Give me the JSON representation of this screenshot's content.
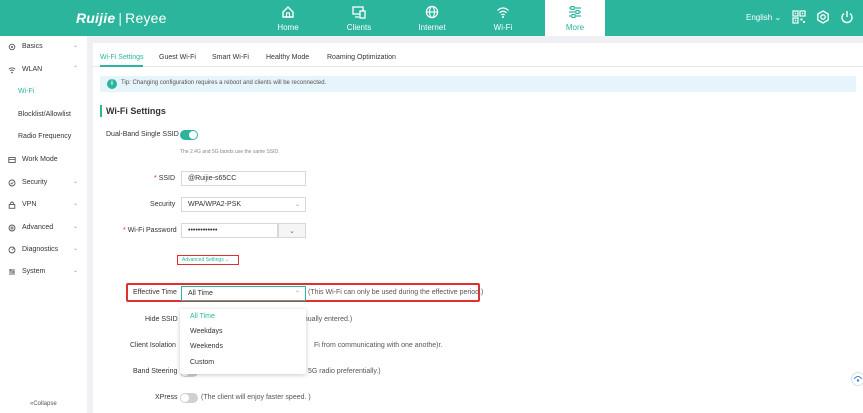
{
  "header": {
    "logo_brand": "Ruijie",
    "logo_sep": "|",
    "logo_sub": "Reyee",
    "nav": [
      {
        "label": "Home",
        "icon": "home-icon"
      },
      {
        "label": "Clients",
        "icon": "clients-icon"
      },
      {
        "label": "Internet",
        "icon": "globe-icon"
      },
      {
        "label": "Wi-Fi",
        "icon": "wifi-icon"
      },
      {
        "label": "More",
        "icon": "more-icon",
        "active": true
      }
    ],
    "language": "English",
    "language_caret": "⌄",
    "icons": [
      "qr-code-icon",
      "network-icon",
      "logout-icon"
    ]
  },
  "sidebar": {
    "items": [
      {
        "label": "Basics",
        "icon": "gear-icon",
        "chevron": "⌄"
      },
      {
        "label": "WLAN",
        "icon": "wifi-icon",
        "chevron": "⌃"
      },
      {
        "label": "Work Mode",
        "icon": "work-mode-icon",
        "chevron": ""
      },
      {
        "label": "Security",
        "icon": "security-icon",
        "chevron": "⌄"
      },
      {
        "label": "VPN",
        "icon": "vpn-icon",
        "chevron": "⌄"
      },
      {
        "label": "Advanced",
        "icon": "advanced-icon",
        "chevron": "⌄"
      },
      {
        "label": "Diagnostics",
        "icon": "diagnostics-icon",
        "chevron": "⌄"
      },
      {
        "label": "System",
        "icon": "system-icon",
        "chevron": "⌄"
      }
    ],
    "sub_items": [
      {
        "label": "Wi-Fi",
        "active": true
      },
      {
        "label": "Blocklist/Allowlist"
      },
      {
        "label": "Radio Frequency"
      }
    ],
    "collapse": "«Collapse"
  },
  "tabs": [
    "Wi-Fi Settings",
    "Guest Wi-Fi",
    "Smart Wi-Fi",
    "Healthy Mode",
    "Roaming Optimization"
  ],
  "tip": {
    "icon": "i",
    "text": "Tip: Changing configuration requires a reboot and clients will be reconnected."
  },
  "section_title": "Wi-Fi Settings",
  "form": {
    "dual_band_label": "Dual-Band Single SSID",
    "dual_band_on": true,
    "dual_band_hint": "The 2.4G and 5G bands use the same SSID.",
    "required_mark": "*",
    "ssid_label": "SSID",
    "ssid_value": "@Ruijie-s65CC",
    "security_label": "Security",
    "security_value": "WPA/WPA2-PSK",
    "select_arrow": "⌄",
    "password_label": "Wi-Fi Password",
    "password_value": "••••••••••••",
    "password_toggle": "⌄",
    "advanced_link": "Advanced Settings ⌄",
    "effective_time_label": "Effective Time",
    "effective_time_value": "All Time",
    "effective_time_arrow": "⌃",
    "effective_time_note": "(This Wi-Fi can only be used during the effective period.)",
    "effective_time_options": [
      "All Time",
      "Weekdays",
      "Weekends",
      "Custom"
    ],
    "hide_ssid_label": "Hide SSID",
    "hide_ssid_note_partial": "anually entered.)",
    "client_isolation_label": "Client Isolation",
    "client_isolation_note_partial": "Fi from communicating with one anothe)r.",
    "band_steering_label": "Band Steering",
    "band_steering_note_partial": "5G radio preferentially.)",
    "xpress_label": "XPress",
    "xpress_note": "(The client will enjoy faster speed. )"
  },
  "colors": {
    "brand": "#2bb59c",
    "highlight": "#e03030"
  }
}
